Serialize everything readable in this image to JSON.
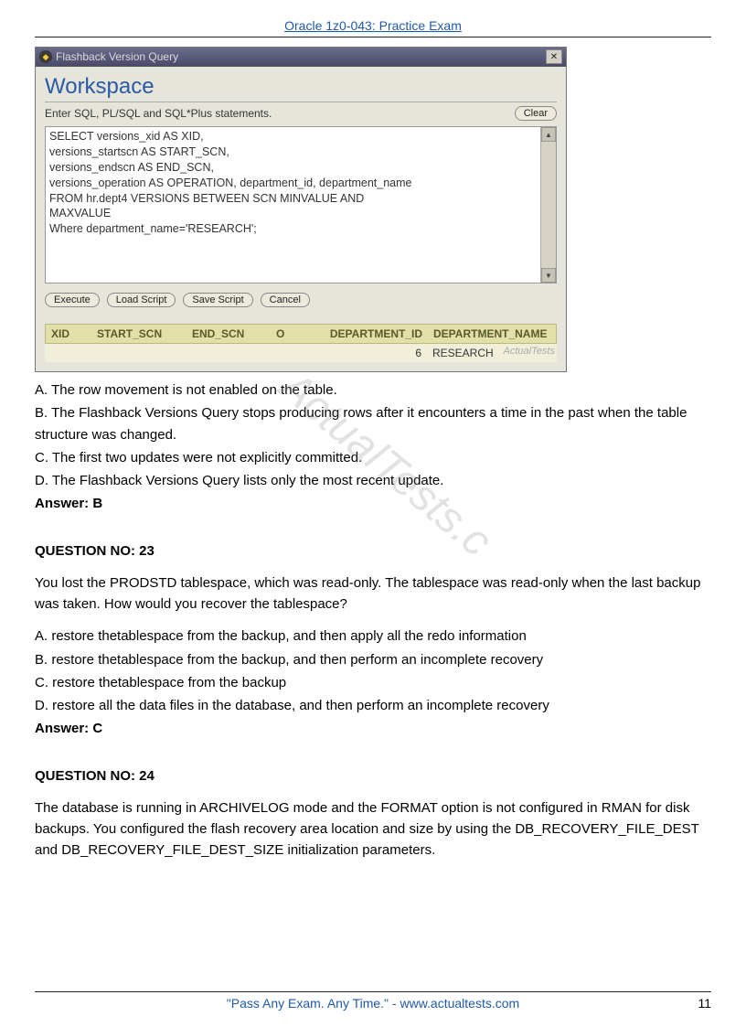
{
  "header": {
    "title": "Oracle 1z0-043: Practice Exam"
  },
  "screenshot": {
    "titlebar": "Flashback Version Query",
    "workspace_title": "Workspace",
    "prompt": "Enter SQL, PL/SQL and SQL*Plus statements.",
    "clear_label": "Clear",
    "sql_lines": [
      "SELECT versions_xid AS XID,",
      "versions_startscn AS START_SCN,",
      "versions_endscn AS END_SCN,",
      "versions_operation AS OPERATION, department_id, department_name",
      "FROM hr.dept4 VERSIONS BETWEEN SCN MINVALUE AND",
      "MAXVALUE",
      "Where department_name='RESEARCH';"
    ],
    "buttons": {
      "execute": "Execute",
      "load": "Load Script",
      "save": "Save Script",
      "cancel": "Cancel"
    },
    "result_headers": {
      "xid": "XID",
      "start_scn": "START_SCN",
      "end_scn": "END_SCN",
      "op": "O",
      "dept_id": "DEPARTMENT_ID",
      "dept_name": "DEPARTMENT_NAME"
    },
    "result_row": {
      "xid": "",
      "start_scn": "",
      "end_scn": "",
      "op": "",
      "dept_id": "6",
      "dept_name": "RESEARCH"
    },
    "row_watermark": "ActualTests"
  },
  "q22_options": {
    "a": "A. The row movement is not enabled on the table.",
    "b": "B. The Flashback Versions Query stops producing rows after it encounters a time in the past when the table structure was changed.",
    "c": "C. The first two updates were not explicitly committed.",
    "d": "D. The Flashback Versions Query lists only the most recent update."
  },
  "q22_answer": "Answer: B",
  "q23": {
    "title": "QUESTION NO: 23",
    "stem": "You lost the PRODSTD tablespace, which was read-only. The tablespace was read-only when the last backup was taken. How would you recover the tablespace?",
    "a": "A. restore thetablespace from the backup, and then apply all the redo information",
    "b": "B. restore thetablespace from the backup, and then perform an incomplete recovery",
    "c": "C. restore thetablespace from the backup",
    "d": "D. restore all the data files in the database, and then perform an incomplete recovery",
    "answer": "Answer: C"
  },
  "q24": {
    "title": "QUESTION NO: 24",
    "stem": "The database is running in ARCHIVELOG mode and the FORMAT option is not configured in RMAN for disk backups. You configured the flash recovery area location and size by using the DB_RECOVERY_FILE_DEST and DB_RECOVERY_FILE_DEST_SIZE initialization parameters."
  },
  "footer": {
    "text": "\"Pass Any Exam. Any Time.\"  -  www.actualtests.com",
    "page": "11"
  },
  "watermark": "ActualTests.c"
}
